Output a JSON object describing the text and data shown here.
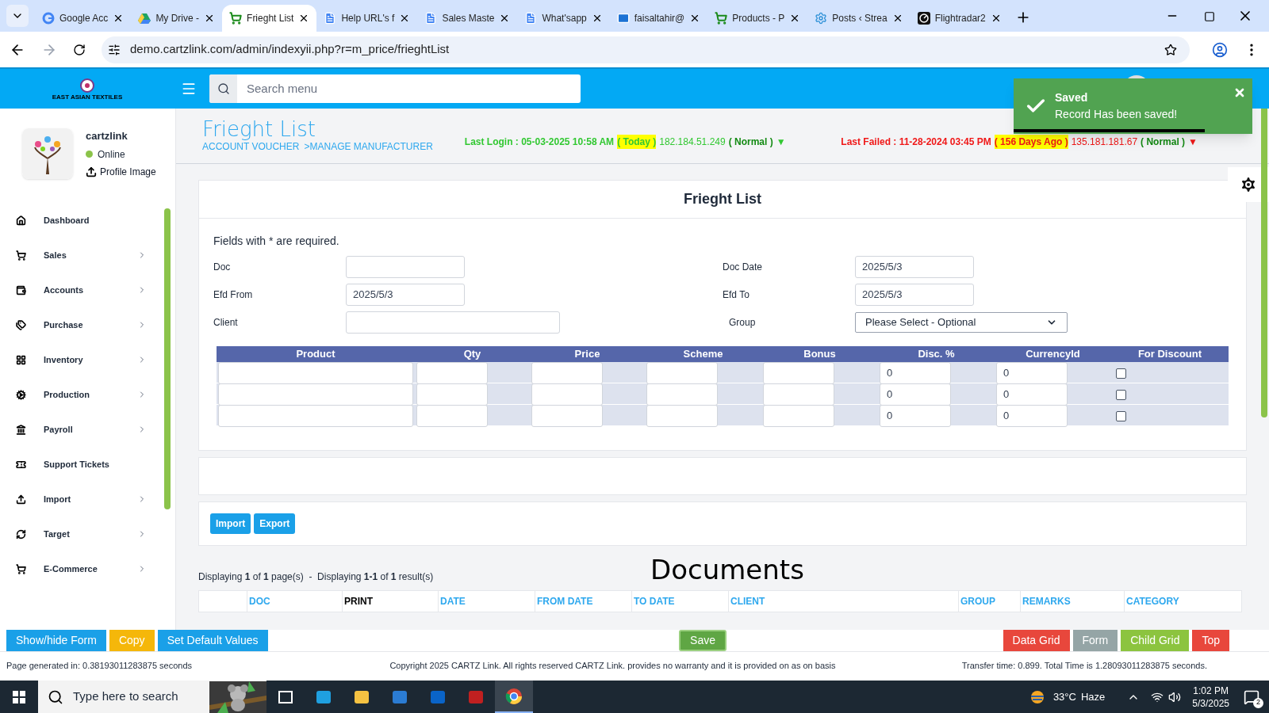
{
  "browser": {
    "tabs": [
      {
        "title": "Google Acc",
        "selected": false
      },
      {
        "title": "My Drive - ",
        "selected": false
      },
      {
        "title": "Frieght List",
        "selected": true
      },
      {
        "title": "Help URL's f",
        "selected": false
      },
      {
        "title": "Sales Maste",
        "selected": false
      },
      {
        "title": "What'sapp",
        "selected": false
      },
      {
        "title": "faisaltahir@",
        "selected": false
      },
      {
        "title": "Products - P",
        "selected": false
      },
      {
        "title": "Posts ‹ Strea",
        "selected": false
      },
      {
        "title": "Flightradar2",
        "selected": false
      }
    ],
    "url": "demo.cartzlink.com/admin/indexyii.php?r=m_price/frieghtList"
  },
  "header": {
    "logo_text": "EAST ASIAN TEXTILES",
    "search_placeholder": "Search menu"
  },
  "toast": {
    "title": "Saved",
    "message": "Record Has been saved!",
    "level": 0.8
  },
  "profile": {
    "name": "cartzlink",
    "status": "Online",
    "upload": "Profile Image"
  },
  "sidebar": {
    "items": [
      {
        "label": "Dashboard",
        "submenu": false
      },
      {
        "label": "Sales",
        "submenu": true
      },
      {
        "label": "Accounts",
        "submenu": true
      },
      {
        "label": "Purchase",
        "submenu": true
      },
      {
        "label": "Inventory",
        "submenu": true
      },
      {
        "label": "Production",
        "submenu": true
      },
      {
        "label": "Payroll",
        "submenu": true
      },
      {
        "label": "Support Tickets",
        "submenu": false
      },
      {
        "label": "Import",
        "submenu": true
      },
      {
        "label": "Target",
        "submenu": true
      },
      {
        "label": "E-Commerce",
        "submenu": true
      }
    ]
  },
  "page": {
    "title": "Frieght List",
    "breadcrumbs": [
      "ACCOUNT VOUCHER",
      ">MANAGE MANUFACTURER"
    ],
    "logins": [
      {
        "color": "#32c832",
        "parts": [
          {
            "kind": "label",
            "text": "Last Login : 05-03-2025 10:58 AM"
          },
          {
            "kind": "highlight",
            "text": "( Today )"
          },
          {
            "kind": "ip",
            "text": "182.184.51.249"
          },
          {
            "kind": "status",
            "text": "( Normal )"
          },
          {
            "kind": "arrow",
            "text": "▼"
          }
        ]
      },
      {
        "color": "#f01818",
        "parts": [
          {
            "kind": "label",
            "text": "Last Failed : 11-28-2024 03:45 PM"
          },
          {
            "kind": "highlight",
            "text": "( 156 Days Ago )"
          },
          {
            "kind": "ip",
            "text": "135.181.181.67"
          },
          {
            "kind": "status",
            "text": "( Normal )"
          },
          {
            "kind": "arrow",
            "text": "▼"
          }
        ]
      }
    ]
  },
  "form": {
    "title": "Frieght List",
    "required_note": "Fields with * are required.",
    "rows": [
      [
        {
          "label": "Doc",
          "kind": "text"
        },
        {
          "label": "Doc Date",
          "kind": "text",
          "value": "2025/5/3"
        }
      ],
      [
        {
          "label": "Efd From",
          "kind": "text",
          "value": "2025/5/3"
        },
        {
          "label": "Efd To",
          "kind": "text",
          "value": "2025/5/3"
        }
      ],
      [
        {
          "label": "Client",
          "kind": "wide"
        },
        {
          "label": "Group",
          "kind": "select",
          "value": "Please Select - Optional"
        }
      ]
    ],
    "grid": {
      "columns": [
        "Product",
        "Qty",
        "Price",
        "Scheme",
        "Bonus",
        "Disc. %",
        "CurrencyId",
        "For Discount"
      ],
      "rows": [
        {
          "disc": "0",
          "currency": "0",
          "for_discount": false
        },
        {
          "disc": "0",
          "currency": "0",
          "for_discount": false
        },
        {
          "disc": "0",
          "currency": "0",
          "for_discount": false
        }
      ]
    }
  },
  "actions": [
    "Import",
    "Export"
  ],
  "documents": {
    "title": "Documents",
    "summary": "Displaying **1** of **1** page(s)  -  Displaying **1-1** of **1** result(s)",
    "columns": [
      {
        "label": "DOC",
        "link": true
      },
      {
        "label": "PRINT",
        "link": false
      },
      {
        "label": "DATE",
        "link": true
      },
      {
        "label": "FROM DATE",
        "link": true
      },
      {
        "label": "TO DATE",
        "link": true
      },
      {
        "label": "CLIENT",
        "link": true
      },
      {
        "label": "GROUP",
        "link": true
      },
      {
        "label": "REMARKS",
        "link": true
      },
      {
        "label": "CATEGORY",
        "link": true
      }
    ]
  },
  "toolbar": {
    "left": [
      {
        "label": "Show/hide Form",
        "color": "#1aa0e8"
      },
      {
        "label": "Copy",
        "color": "#f5b70a"
      },
      {
        "label": "Set Default Values",
        "color": "#1aa0e8"
      }
    ],
    "center": {
      "label": "Save",
      "color": "#5fa644"
    },
    "right": [
      {
        "label": "Data Grid",
        "color": "#e8473c"
      },
      {
        "label": "Form",
        "color": "#95a5a6"
      },
      {
        "label": "Child Grid",
        "color": "#8cc43f"
      },
      {
        "label": "Top",
        "color": "#e8473c"
      }
    ]
  },
  "footer": {
    "left": "Page generated in: 0.38193011283875 seconds",
    "center": "Copyright 2025 CARTZ Link. All rights reserved CARTZ Link. provides no warranty and it is provided on as on basis",
    "right": "Transfer time: 0.899. Total Time is 1.28093011283875 seconds."
  },
  "taskbar": {
    "search_placeholder": "Type here to search",
    "temperature": "33°C",
    "weather": "Haze",
    "time": "1:02 PM",
    "date": "5/3/2025",
    "notifications": "2",
    "apps": [
      {
        "selected": false
      },
      {
        "selected": false
      },
      {
        "selected": false
      },
      {
        "selected": false
      },
      {
        "selected": false
      },
      {
        "selected": false
      },
      {
        "selected": true
      }
    ]
  }
}
